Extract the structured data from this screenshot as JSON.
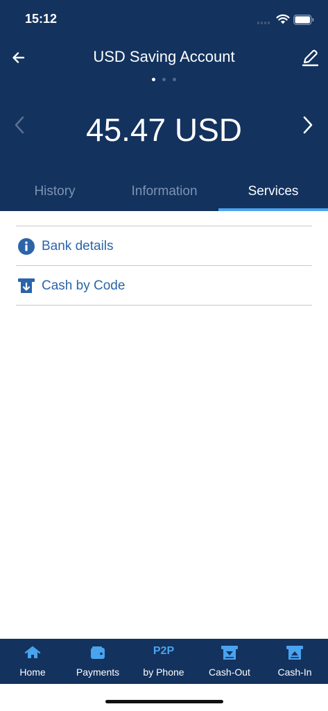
{
  "status_bar": {
    "time": "15:12"
  },
  "header": {
    "title": "USD Saving Account",
    "balance": "45.47 USD",
    "page_dots": 3,
    "active_page": 0
  },
  "tabs": [
    {
      "label": "History",
      "active": false
    },
    {
      "label": "Information",
      "active": false
    },
    {
      "label": "Services",
      "active": true
    }
  ],
  "services": [
    {
      "label": "Bank details",
      "icon": "info-icon"
    },
    {
      "label": "Cash by Code",
      "icon": "cash-by-code-icon"
    }
  ],
  "bottom_nav": [
    {
      "label": "Home",
      "icon": "home-icon"
    },
    {
      "label": "Payments",
      "icon": "wallet-icon"
    },
    {
      "label": "by Phone",
      "icon_text": "P2P"
    },
    {
      "label": "Cash-Out",
      "icon": "cash-out-icon"
    },
    {
      "label": "Cash-In",
      "icon": "cash-in-icon"
    }
  ],
  "colors": {
    "header_bg": "#13325e",
    "accent": "#4aa3ee",
    "link": "#2b64a9"
  }
}
